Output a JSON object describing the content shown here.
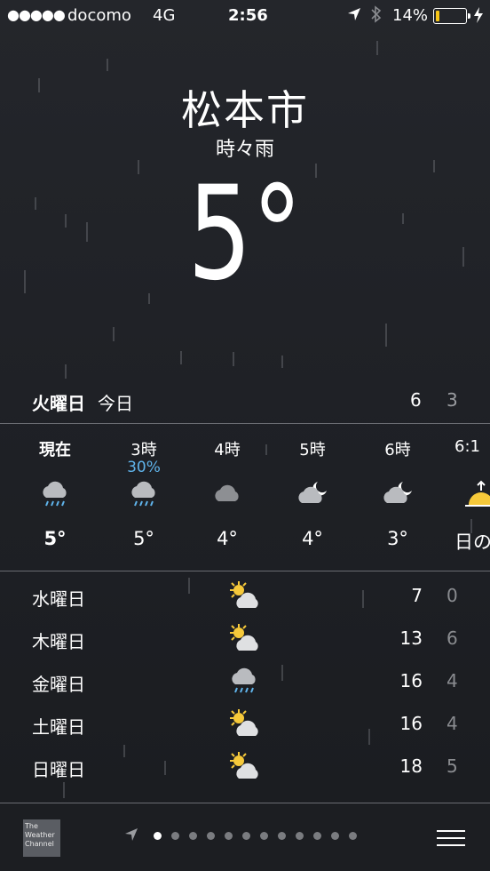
{
  "status_bar": {
    "signal": "●●●●●",
    "carrier": "docomo",
    "network": "4G",
    "time": "2:56",
    "battery_percent": "14%",
    "battery_level": 0.14,
    "battery_color": "#f5c518"
  },
  "location": {
    "city": "松本市",
    "condition": "時々雨",
    "temperature": "5°"
  },
  "today": {
    "day": "火曜日",
    "label": "今日",
    "high": "6",
    "low": "3"
  },
  "hourly": [
    {
      "time": "現在",
      "precip": "",
      "icon": "rain-cloud-icon",
      "temp": "5°"
    },
    {
      "time": "3時",
      "precip": "30%",
      "icon": "rain-cloud-icon",
      "temp": "5°"
    },
    {
      "time": "4時",
      "precip": "",
      "icon": "cloud-icon",
      "temp": "4°"
    },
    {
      "time": "5時",
      "precip": "",
      "icon": "partly-cloudy-night-icon",
      "temp": "4°"
    },
    {
      "time": "6時",
      "precip": "",
      "icon": "partly-cloudy-night-icon",
      "temp": "3°"
    },
    {
      "time": "6:1",
      "precip": "",
      "icon": "sunrise-icon",
      "temp": "日の"
    }
  ],
  "daily": [
    {
      "day": "水曜日",
      "icon": "partly-sunny-icon",
      "high": "7",
      "low": "0"
    },
    {
      "day": "木曜日",
      "icon": "partly-sunny-icon",
      "high": "13",
      "low": "6"
    },
    {
      "day": "金曜日",
      "icon": "rain-cloud-icon",
      "high": "16",
      "low": "4"
    },
    {
      "day": "土曜日",
      "icon": "partly-sunny-icon",
      "high": "16",
      "low": "4"
    },
    {
      "day": "日曜日",
      "icon": "partly-sunny-icon",
      "high": "18",
      "low": "5"
    }
  ],
  "footer": {
    "provider_line1": "The",
    "provider_line2": "Weather",
    "provider_line3": "Channel",
    "page_count": 12,
    "active_page": 0
  },
  "colors": {
    "precip_blue": "#5fb3ea",
    "sun_yellow": "#f6c93a"
  }
}
